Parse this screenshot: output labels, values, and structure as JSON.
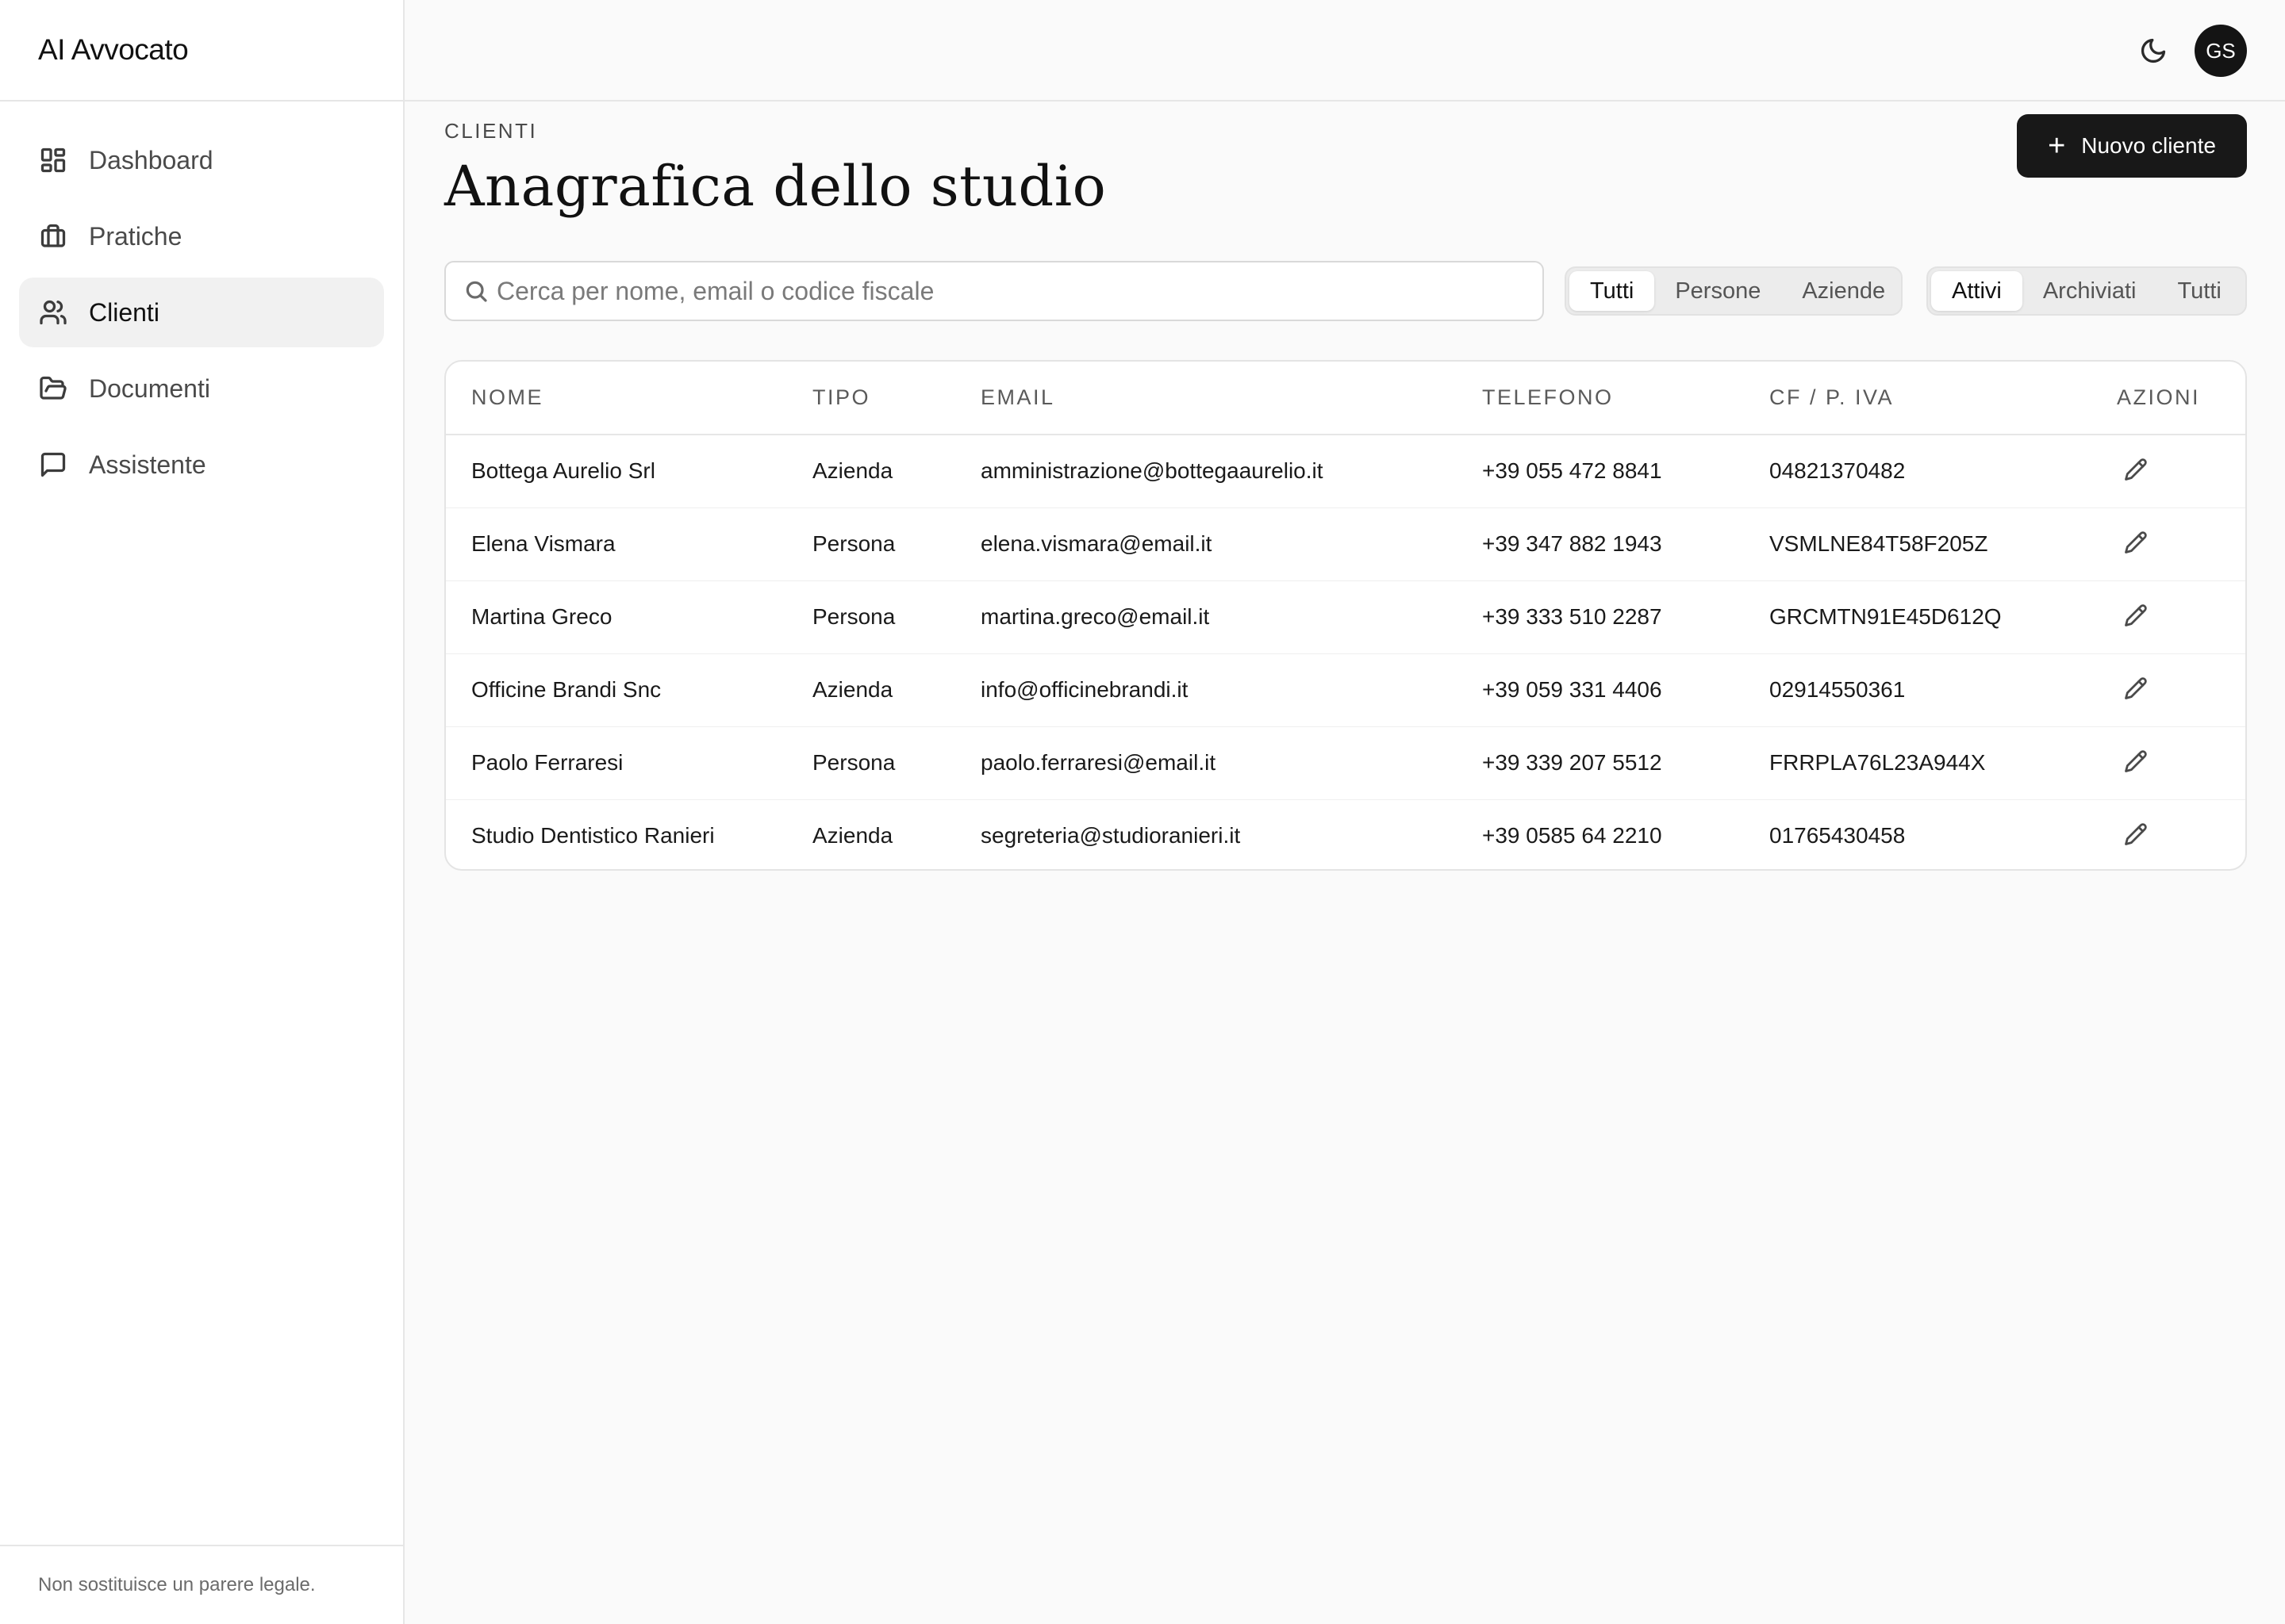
{
  "app": {
    "name": "AI Avvocato"
  },
  "sidebar": {
    "items": [
      {
        "label": "Dashboard",
        "icon": "dashboard-icon"
      },
      {
        "label": "Pratiche",
        "icon": "briefcase-icon"
      },
      {
        "label": "Clienti",
        "icon": "users-icon",
        "active": true
      },
      {
        "label": "Documenti",
        "icon": "folder-open-icon"
      },
      {
        "label": "Assistente",
        "icon": "message-square-icon"
      }
    ],
    "footer": "Non sostituisce un parere legale."
  },
  "topbar": {
    "avatar_initials": "GS",
    "theme_icon": "moon-icon"
  },
  "page": {
    "eyebrow": "CLIENTI",
    "title": "Anagrafica dello studio",
    "new_button": "Nuovo cliente"
  },
  "search": {
    "placeholder": "Cerca per nome, email o codice fiscale",
    "value": ""
  },
  "filters": {
    "type": {
      "options": [
        "Tutti",
        "Persone",
        "Aziende"
      ],
      "selected": "Tutti"
    },
    "status": {
      "options": [
        "Attivi",
        "Archiviati",
        "Tutti"
      ],
      "selected": "Attivi"
    }
  },
  "table": {
    "columns": [
      "NOME",
      "TIPO",
      "EMAIL",
      "TELEFONO",
      "CF / P. IVA",
      "AZIONI"
    ],
    "rows": [
      {
        "nome": "Bottega Aurelio Srl",
        "tipo": "Azienda",
        "email": "amministrazione@bottegaaurelio.it",
        "telefono": "+39 055 472 8841",
        "cf": "04821370482"
      },
      {
        "nome": "Elena Vismara",
        "tipo": "Persona",
        "email": "elena.vismara@email.it",
        "telefono": "+39 347 882 1943",
        "cf": "VSMLNE84T58F205Z"
      },
      {
        "nome": "Martina Greco",
        "tipo": "Persona",
        "email": "martina.greco@email.it",
        "telefono": "+39 333 510 2287",
        "cf": "GRCMTN91E45D612Q"
      },
      {
        "nome": "Officine Brandi Snc",
        "tipo": "Azienda",
        "email": "info@officinebrandi.it",
        "telefono": "+39 059 331 4406",
        "cf": "02914550361"
      },
      {
        "nome": "Paolo Ferraresi",
        "tipo": "Persona",
        "email": "paolo.ferraresi@email.it",
        "telefono": "+39 339 207 5512",
        "cf": "FRRPLA76L23A944X"
      },
      {
        "nome": "Studio Dentistico Ranieri",
        "tipo": "Azienda",
        "email": "segreteria@studioranieri.it",
        "telefono": "+39 0585 64 2210",
        "cf": "01765430458"
      }
    ]
  }
}
